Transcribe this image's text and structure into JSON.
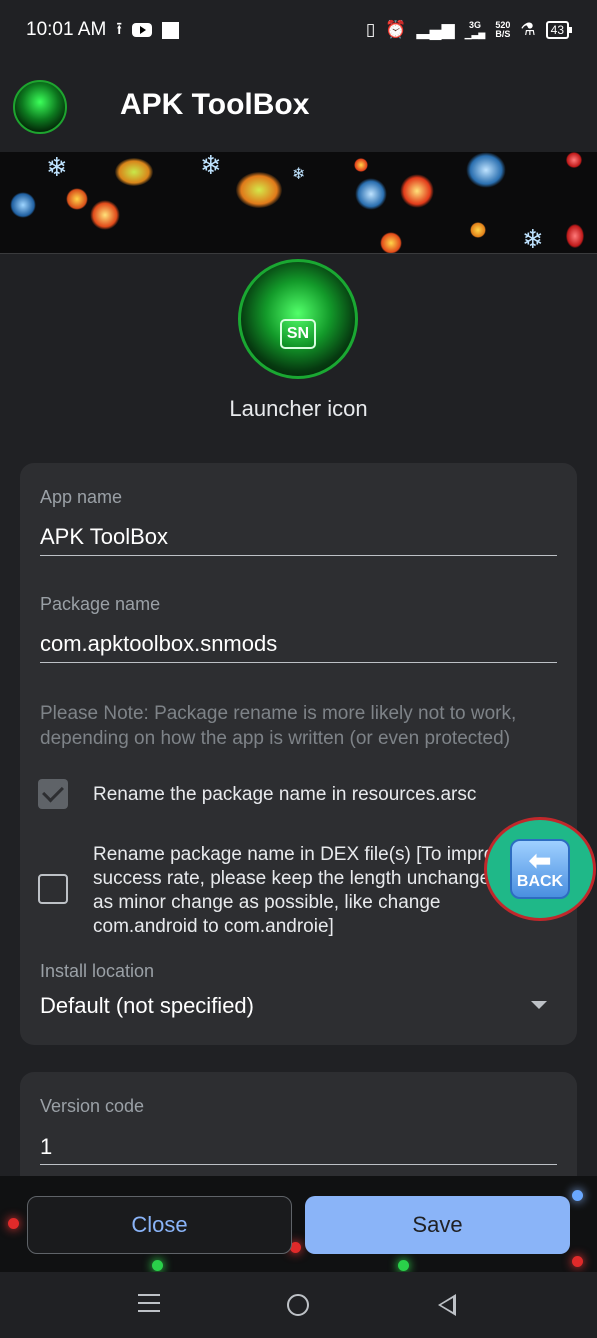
{
  "status_bar": {
    "time": "10:01 AM",
    "net_top": "3G",
    "net_speed_value": "520",
    "net_speed_unit": "B/S",
    "battery": "43"
  },
  "app_bar": {
    "title": "APK ToolBox"
  },
  "launcher": {
    "label": "Launcher icon",
    "monogram": "SN"
  },
  "form": {
    "app_name_label": "App name",
    "app_name_value": "APK ToolBox",
    "package_name_label": "Package name",
    "package_name_value": "com.apktoolbox.snmods",
    "note": "Please Note: Package rename is more likely not to work, depending on how the app is written (or even protected)",
    "rename_resources_label": "Rename the package name in resources.arsc",
    "rename_resources_checked": true,
    "rename_dex_label": "Rename package name in DEX file(s) [To improve success rate, please keep the length unchanged, do as minor change as possible, like change com.android to com.androie]",
    "rename_dex_checked": false,
    "install_location_label": "Install location",
    "install_location_value": "Default (not specified)",
    "version_code_label": "Version code",
    "version_code_value": "1"
  },
  "floating_button": {
    "label": "BACK"
  },
  "actions": {
    "close_label": "Close",
    "save_label": "Save"
  },
  "colors": {
    "background": "#202124",
    "card": "#2d2e31",
    "accent": "#8ab4f8"
  }
}
